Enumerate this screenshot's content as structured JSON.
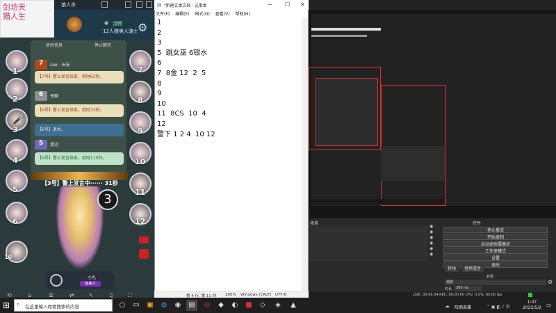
{
  "game": {
    "window_title": "狼人杀",
    "logo_text": "剑坊天\n猫人生",
    "server_status": "流畅",
    "room_desc": "12人狼美人骑士",
    "tabs": [
      "房间信息",
      "停止聊天"
    ],
    "chat": [
      {
        "badge": "7",
        "name": "Leo - 长安",
        "msg": "【7号】警上发言结束，用时63秒。"
      },
      {
        "badge": "6",
        "name": "无聊",
        "msg": "【6号】警上发言结束，用时73秒。"
      },
      {
        "badge": "",
        "name": "",
        "msg": "【6号】退水。"
      },
      {
        "badge": "5",
        "name": "清河",
        "msg": "【5号】警上发言结束，用时115秒。"
      }
    ],
    "speak_status": "【3号】警上发言中······ 31秒",
    "seats_left": [
      "1",
      "2",
      "3",
      "4",
      "5",
      "6",
      "10"
    ],
    "seats_right": [
      "7",
      "8",
      "9",
      "10",
      "11",
      "12"
    ],
    "center_seat": "3",
    "bottom_name": "小九",
    "bottom_role": "狼美人"
  },
  "notepad": {
    "title": "*新建文本文档 - 记事本",
    "menu": [
      "文件(F)",
      "编辑(E)",
      "格式(O)",
      "查看(V)",
      "帮助(H)"
    ],
    "content": "1\n2\n3\n5  跳女巫 6银水\n6\n7  8金 12  2  5\n8\n9\n10\n11  8CS  10  4\n12\n警下 1 2 4  10 12",
    "status": {
      "position": "第 4 行, 第 11 列",
      "zoom": "100%",
      "eol": "Windows (CRLF)",
      "encoding": "UTF-8"
    }
  },
  "obs": {
    "scenes_title": "场景",
    "controls_title": "控件",
    "controls": [
      "停止推流",
      "开始录制",
      "启动虚拟摄像机",
      "工作室模式",
      "设置",
      "退出"
    ],
    "tabs": [
      "转场",
      "音频混音"
    ],
    "transition_label": "渐变",
    "duration_label": "时长",
    "duration_value": "300 ms",
    "status": "LIVE: 00:06:34   REC: 00:00:00   CPU: 3.0%, 60.00 fps"
  },
  "taskbar": {
    "search_placeholder": "在这里输入你要搜索的内容",
    "tray_weather": "阵雨来袭",
    "time": "1:07",
    "date": "2022/5/2"
  }
}
